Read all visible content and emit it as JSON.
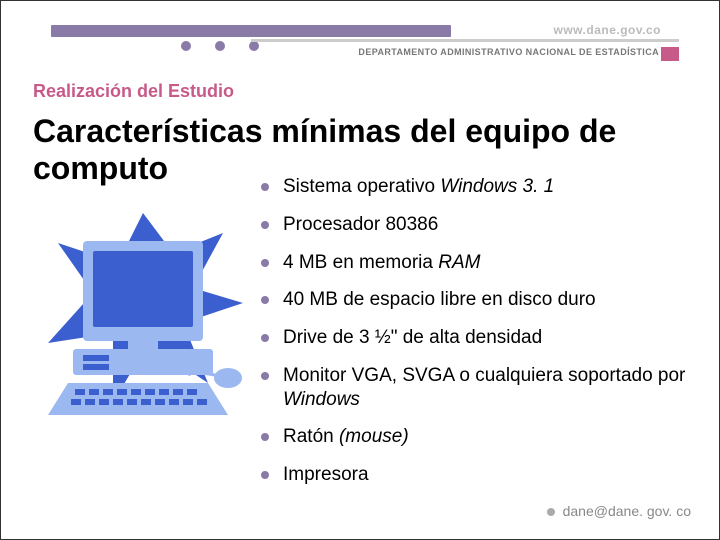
{
  "header": {
    "url": "www.dane.gov.co",
    "subhead": "DEPARTAMENTO ADMINISTRATIVO NACIONAL DE ESTADÍSTICA"
  },
  "section_label": "Realización del Estudio",
  "title": "Características mínimas del equipo de computo",
  "bullets": [
    {
      "html": "Sistema operativo <i>Windows 3. 1</i>"
    },
    {
      "html": "Procesador 80386"
    },
    {
      "html": "4 MB en memoria <i>RAM</i>"
    },
    {
      "html": "40 MB de espacio libre en disco duro"
    },
    {
      "html": "Drive de 3 ½\" de alta densidad"
    },
    {
      "html": "Monitor VGA, SVGA o cualquiera soportado por <i>Windows</i>"
    },
    {
      "html": "Ratón <i>(mouse)</i>"
    },
    {
      "html": "Impresora"
    }
  ],
  "footer_email": "dane@dane. gov. co"
}
